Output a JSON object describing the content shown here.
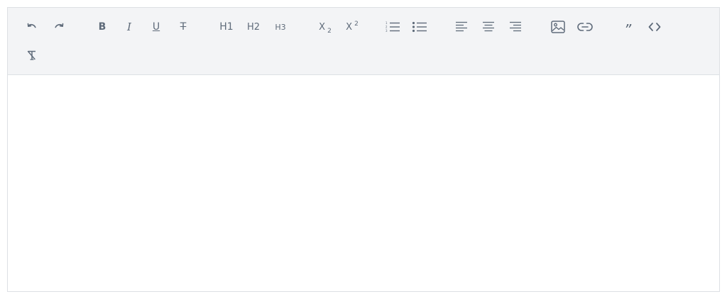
{
  "toolbar": {
    "bold_label": "B",
    "italic_label": "I",
    "underline_label": "U",
    "strike_label": "T",
    "h1_label": "H1",
    "h2_label": "H2",
    "h3_label": "H3",
    "subscript_base": "X",
    "subscript_mark": "2",
    "superscript_base": "X",
    "superscript_mark": "2",
    "blockquote_label": "”",
    "icons": [
      "undo-icon",
      "redo-icon",
      "bold-icon",
      "italic-icon",
      "underline-icon",
      "strikethrough-icon",
      "heading-1-icon",
      "heading-2-icon",
      "heading-3-icon",
      "subscript-icon",
      "superscript-icon",
      "ordered-list-icon",
      "bullet-list-icon",
      "align-left-icon",
      "align-center-icon",
      "align-right-icon",
      "image-icon",
      "link-icon",
      "blockquote-icon",
      "code-icon",
      "clear-format-icon"
    ]
  },
  "editor": {
    "content": ""
  },
  "colors": {
    "toolbar_bg": "#f3f4f6",
    "icon": "#5f6b7a",
    "border": "#dde0e4",
    "content_bg": "#ffffff"
  }
}
